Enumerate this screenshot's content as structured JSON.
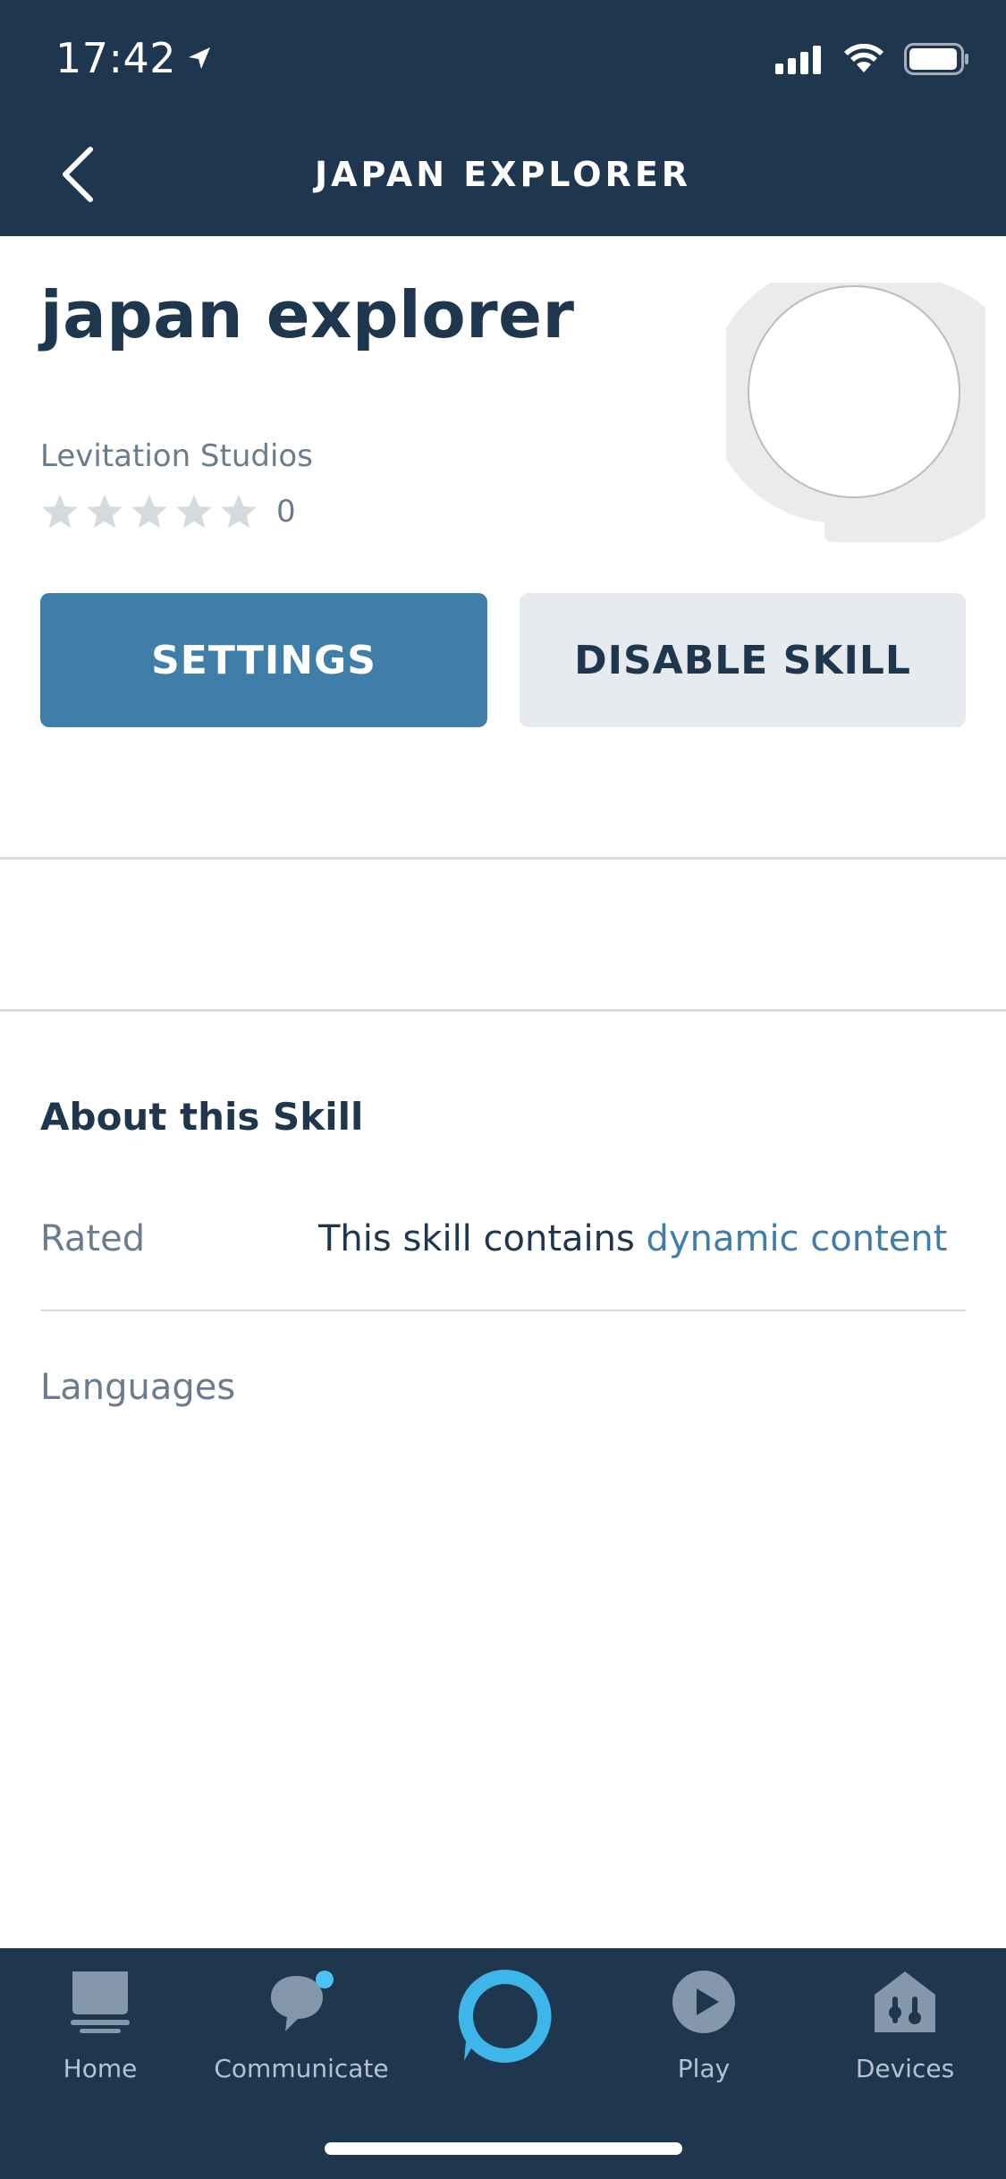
{
  "status_bar": {
    "time": "17:42"
  },
  "header": {
    "title": "JAPAN EXPLORER"
  },
  "skill": {
    "name": "japan explorer",
    "developer": "Levitation Studios",
    "rating_count": "0",
    "rating_stars": 0
  },
  "actions": {
    "settings_label": "SETTINGS",
    "disable_label": "DISABLE SKILL"
  },
  "about": {
    "title": "About this Skill",
    "rated_label": "Rated",
    "rated_text": "This skill contains ",
    "rated_link": "dynamic content",
    "languages_label": "Languages"
  },
  "tabbar": {
    "items": [
      {
        "label": "Home",
        "icon": "home-icon"
      },
      {
        "label": "Communicate",
        "icon": "chat-icon"
      },
      {
        "label": "",
        "icon": "alexa-icon"
      },
      {
        "label": "Play",
        "icon": "play-icon"
      },
      {
        "label": "Devices",
        "icon": "devices-icon"
      }
    ]
  },
  "colors": {
    "header_bg": "#1f364f",
    "primary_button": "#3f7ea8",
    "secondary_button": "#e7ebef",
    "alexa_blue": "#3fb6ea",
    "notification_dot": "#4cc2f5"
  }
}
